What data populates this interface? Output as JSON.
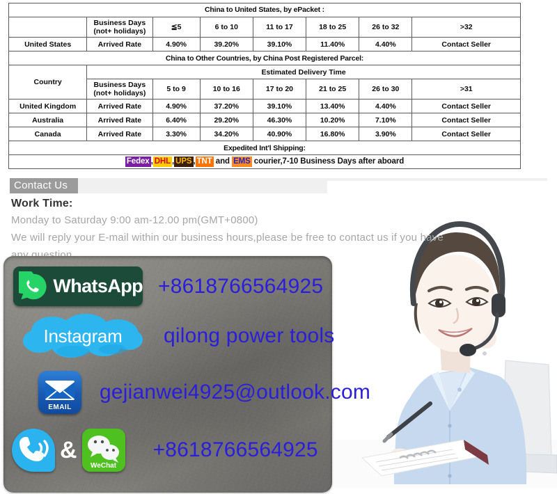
{
  "shipping": {
    "section1_title": "China to United States, by ePacket :",
    "col_business_days": "Business Days",
    "col_business_days_sub": "(not+ holidays)",
    "us_ranges": [
      "≦5",
      "6 to 10",
      "11 to 17",
      "18 to 25",
      "26 to 32",
      ">32"
    ],
    "us_row_label": "United States",
    "arrived_rate_label": "Arrived Rate",
    "us_rates": [
      "4.90%",
      "39.20%",
      "39.10%",
      "11.40%",
      "4.40%",
      "Contact Seller"
    ],
    "section2_title": "China to Other Countries, by China Post Registered Parcel:",
    "country_label": "Country",
    "estimated_delivery_time": "Estimated Delivery Time",
    "other_ranges": [
      "5 to 9",
      "10 to 16",
      "17 to 20",
      "21 to 25",
      "26 to 30",
      ">31"
    ],
    "other_rows": [
      {
        "country": "United Kingdom",
        "metric": "Arrived Rate",
        "values": [
          "4.90%",
          "37.20%",
          "39.10%",
          "13.40%",
          "4.40%",
          "Contact Seller"
        ]
      },
      {
        "country": "Australia",
        "metric": "Arrived Rate",
        "values": [
          "6.40%",
          "29.20%",
          "46.30%",
          "10.20%",
          "7.10%",
          "Contact Seller"
        ]
      },
      {
        "country": "Canada",
        "metric": "Arrived Rate",
        "values": [
          "3.30%",
          "34.20%",
          "40.90%",
          "16.80%",
          "3.90%",
          "Contact Seller"
        ]
      }
    ],
    "expedited_title": "Expedited Int'l Shipping:",
    "couriers": [
      {
        "name": "Fedex",
        "bg": "#7b1fa2",
        "fg": "#ffffff"
      },
      {
        "name": "DHL",
        "bg": "#ffcc00",
        "fg": "#d40511"
      },
      {
        "name": "UPS",
        "bg": "#3b1f0b",
        "fg": "#ffb500"
      },
      {
        "name": "TNT",
        "bg": "#ff7300",
        "fg": "#ffffff"
      },
      {
        "name": "EMS",
        "bg": "#ff8a1e",
        "fg": "#2222cc"
      }
    ],
    "courier_sep": ",",
    "courier_and": "and",
    "courier_tail": "courier,7-10 Business Days after aboard"
  },
  "contact": {
    "tab_label": "Contact Us",
    "work_time_title": "Work Time:",
    "work_time_line": "Monday to Saturday 9:00 am-12.00 pm(GMT+0800)",
    "reply_line_1": "We will reply your E-mail within our business hours,please be free to contact us if you have",
    "reply_line_2": "any question",
    "items": [
      {
        "icon": "whatsapp",
        "brand": "WhatsApp",
        "value": "+8618766564925"
      },
      {
        "icon": "instagram",
        "brand": "Instagram",
        "value": "qilong power tools"
      },
      {
        "icon": "email",
        "brand": "EMAIL",
        "value": "gejianwei4925@outlook.com"
      },
      {
        "icon": "phone-wechat",
        "brand": "WeChat",
        "value": "+8618766564925",
        "amp": "&"
      }
    ],
    "value_color": "#2b1ddb"
  }
}
